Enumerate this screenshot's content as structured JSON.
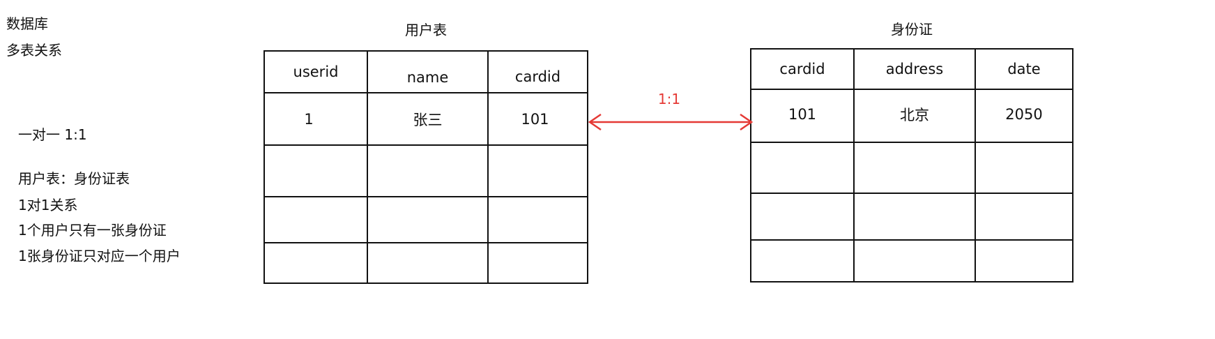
{
  "notes": {
    "heading_lines": [
      "数据库",
      "多表关系"
    ],
    "one_to_one": "一对一 1:1",
    "lines": [
      "用户表：身份证表",
      "1对1关系",
      "1个用户只有一张身份证",
      "1张身份证只对应一个用户"
    ]
  },
  "user_table": {
    "title": "用户表",
    "columns": [
      "userid",
      "name",
      "cardid"
    ],
    "rows": [
      [
        "1",
        "张三",
        "101"
      ],
      [
        "",
        "",
        ""
      ],
      [
        "",
        "",
        ""
      ],
      [
        "",
        "",
        ""
      ]
    ]
  },
  "id_table": {
    "title": "身份证",
    "columns": [
      "cardid",
      "address",
      "date"
    ],
    "rows": [
      [
        "101",
        "北京",
        "2050"
      ],
      [
        "",
        "",
        ""
      ],
      [
        "",
        "",
        ""
      ],
      [
        "",
        "",
        ""
      ]
    ]
  },
  "relation": {
    "label": "1:1",
    "color": "#e53935"
  }
}
